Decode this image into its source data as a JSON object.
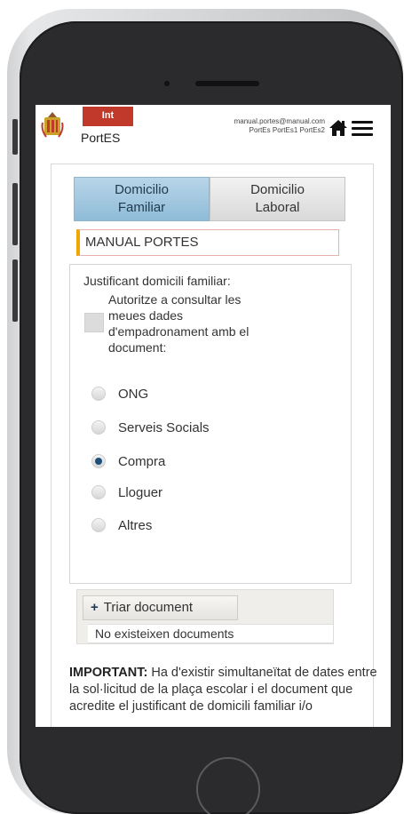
{
  "header": {
    "badge": "Int",
    "app_name": "PortES",
    "user_email": "manual.portes@manual.com",
    "user_names": "PortEs PortEs1 PortEs2"
  },
  "tabs": [
    {
      "label": "Domicilio\nFamiliar",
      "active": true
    },
    {
      "label": "Domicilio\nLaboral",
      "active": false
    }
  ],
  "name_field": {
    "value": "MANUAL PORTES"
  },
  "document_section": {
    "label": "Justificant domicili familiar:",
    "consent_text": "Autoritze a consultar les\nmeues dades\nd'empadronament amb el\ndocument:",
    "options": [
      {
        "label": "ONG",
        "checked": false
      },
      {
        "label": "Serveis Socials",
        "checked": false
      },
      {
        "label": "Compra",
        "checked": true
      },
      {
        "label": "Lloguer",
        "checked": false
      },
      {
        "label": "Altres",
        "checked": false
      }
    ]
  },
  "upload": {
    "button_label": "Triar document",
    "empty_message": "No existeixen documents"
  },
  "notice": {
    "bold_prefix": "IMPORTANT:",
    "text": " Ha d'existir simultaneïtat de dates entre la sol·licitud de la plaça escolar i el document que acredite el justificant de domicili familiar i/o"
  },
  "colors": {
    "badge": "#c0392b",
    "tab_active": "#8fbcd8",
    "field_accent": "#f0a500",
    "radio_checked": "#1d4f7a"
  },
  "icons": [
    "home-icon",
    "menu-icon",
    "plus-icon",
    "city-logo"
  ]
}
